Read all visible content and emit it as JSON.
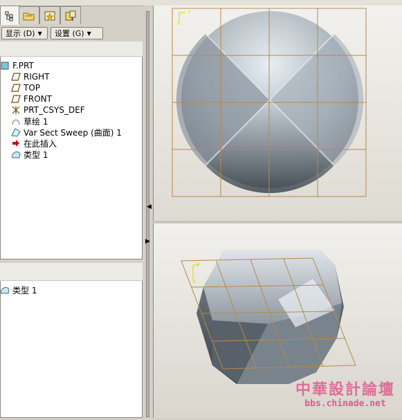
{
  "toolbar": {
    "show_menu_label": "显示 (D)",
    "settings_menu_label": "设置 (G)"
  },
  "model_tree": {
    "root": "F.PRT",
    "items": [
      {
        "label": "RIGHT",
        "icon": "datum-plane-icon"
      },
      {
        "label": "TOP",
        "icon": "datum-plane-icon"
      },
      {
        "label": "FRONT",
        "icon": "datum-plane-icon"
      },
      {
        "label": "PRT_CSYS_DEF",
        "icon": "csys-icon"
      },
      {
        "label": "草绘 1",
        "icon": "sketch-icon"
      },
      {
        "label": "Var Sect Sweep (曲面) 1",
        "icon": "sweep-icon"
      },
      {
        "label": "在此插入",
        "icon": "insert-here-arrow-icon"
      },
      {
        "label": "类型 1",
        "icon": "surface-feature-icon"
      }
    ]
  },
  "lower_tree": {
    "items": [
      {
        "label": "类型 1",
        "icon": "surface-feature-icon"
      }
    ]
  },
  "colors": {
    "panel_bg": "#d4d0c8",
    "grid_lines": "#b5894a",
    "csys_label": "#e0d000",
    "watermark": "#e05a8f"
  },
  "watermark": {
    "line1": "中華設計論壇",
    "line2": "bbs.chinade.net"
  }
}
